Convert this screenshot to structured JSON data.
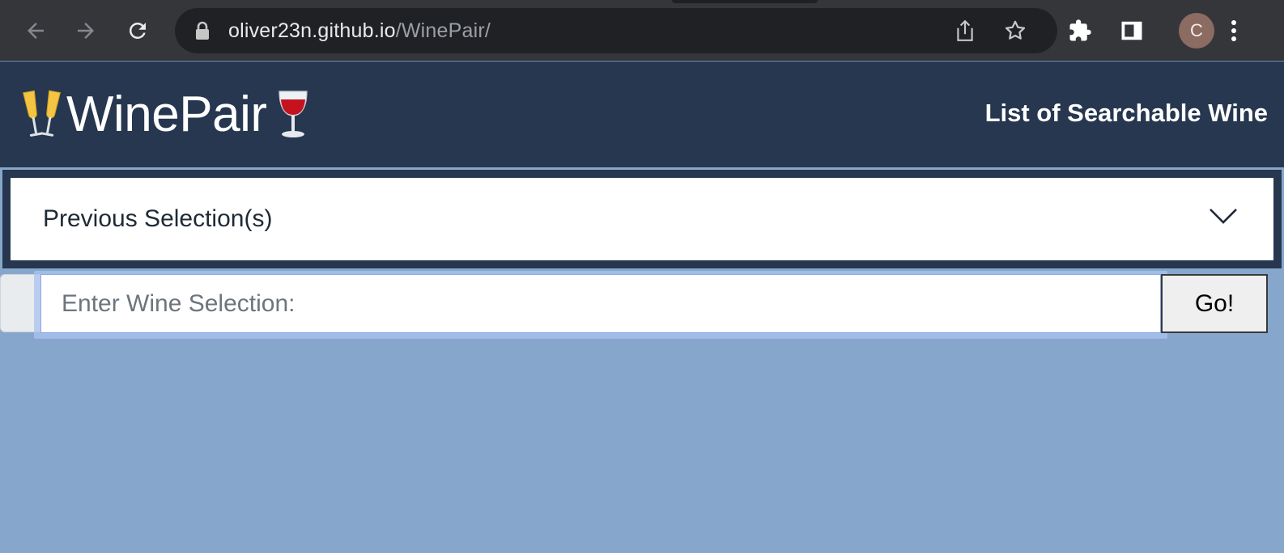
{
  "browser": {
    "url_host": "oliver23n.github.io",
    "url_path": "/WinePair/",
    "avatar_letter": "C",
    "icons": [
      "back-arrow-icon",
      "forward-arrow-icon",
      "reload-icon",
      "lock-icon",
      "share-icon",
      "star-icon",
      "extensions-icon",
      "side-panel-icon",
      "more-icon"
    ]
  },
  "header": {
    "emoji_left": "🥂",
    "title": "WinePair",
    "emoji_right": "🍷",
    "nav_link": "List of Searchable Wine",
    "background": "#26374f"
  },
  "accordion": {
    "label": "Previous Selection(s)",
    "expanded": false
  },
  "search": {
    "value": "",
    "placeholder": "Enter Wine Selection:",
    "button_label": "Go!"
  },
  "colors": {
    "page_background": "#87a6cb",
    "header_navy": "#26374f"
  }
}
